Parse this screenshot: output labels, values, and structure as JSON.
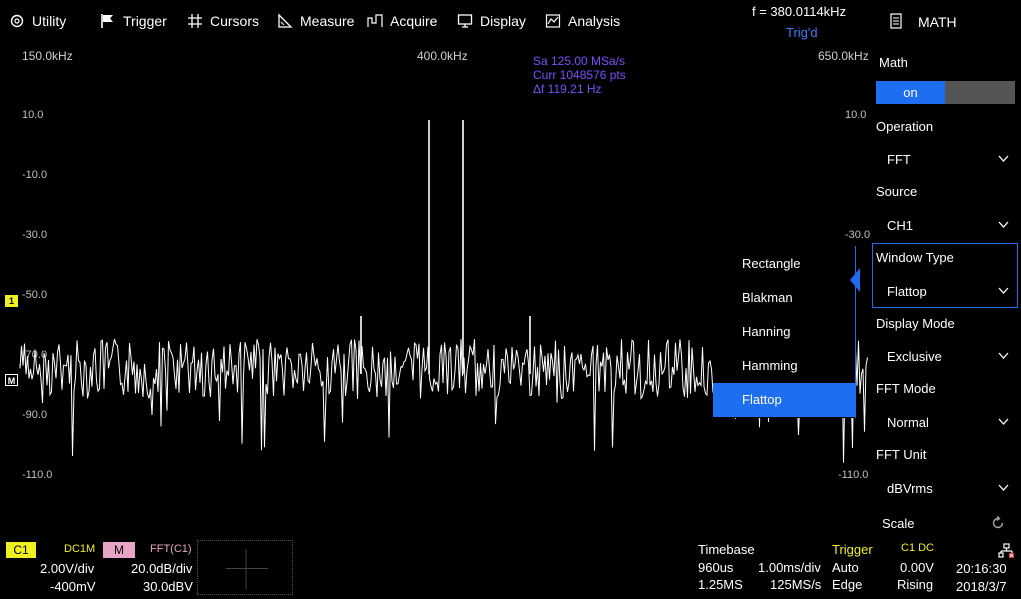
{
  "menu": {
    "utility": "Utility",
    "trigger": "Trigger",
    "cursors": "Cursors",
    "measure": "Measure",
    "acquire": "Acquire",
    "display": "Display",
    "analysis": "Analysis"
  },
  "header": {
    "frequency": "f = 380.0114kHz",
    "trigger_state": "Trig'd"
  },
  "scope": {
    "freq_left": "150.0kHz",
    "freq_center": "400.0kHz",
    "freq_right": "650.0kHz",
    "db_ticks": [
      "10.0",
      "-10.0",
      "-30.0",
      "-50.0",
      "-70.0",
      "-90.0",
      "-110.0"
    ],
    "right_ticks": [
      "10.0",
      "-30.0",
      "-110.0"
    ],
    "info": {
      "sample_rate": "Sa 125.00 MSa/s",
      "curr_points": "Curr 1048576 pts",
      "delta_f": "Δf 119.21 Hz"
    },
    "ch1_marker": "1",
    "math_marker": "M",
    "colors": {
      "ch1": "#f0f020",
      "trace": "#ffffff",
      "info": "#7c4dff"
    }
  },
  "window_dropdown": {
    "options": [
      "Rectangle",
      "Blakman",
      "Hanning",
      "Hamming",
      "Flattop"
    ],
    "selected": "Flattop"
  },
  "panel": {
    "title": "MATH",
    "math_label": "Math",
    "math_state": "on",
    "operation_label": "Operation",
    "operation_value": "FFT",
    "source_label": "Source",
    "source_value": "CH1",
    "window_label": "Window Type",
    "window_value": "Flattop",
    "display_mode_label": "Display Mode",
    "display_mode_value": "Exclusive",
    "fft_mode_label": "FFT Mode",
    "fft_mode_value": "Normal",
    "fft_unit_label": "FFT Unit",
    "fft_unit_value": "dBVrms",
    "scale_label": "Scale",
    "accent_color": "#1d6ef0"
  },
  "status": {
    "c1_badge": "C1",
    "c1_coupling": "DC1M",
    "c1_vdiv": "2.00V/div",
    "c1_offset": "-400mV",
    "m_badge": "M",
    "m_source": "FFT(C1)",
    "m_div": "20.0dB/div",
    "m_offset": "30.0dBV",
    "timebase_label": "Timebase",
    "timebase_delay": "960us",
    "timebase_div": "1.00ms/div",
    "memory_depth": "1.25MS",
    "sample_rate": "125MS/s",
    "trigger_label": "Trigger",
    "trigger_mode": "Auto",
    "trigger_type": "Edge",
    "trigger_source": "C1 DC",
    "trigger_level": "0.00V",
    "trigger_slope": "Rising",
    "time": "20:16:30",
    "date": "2018/3/7"
  }
}
